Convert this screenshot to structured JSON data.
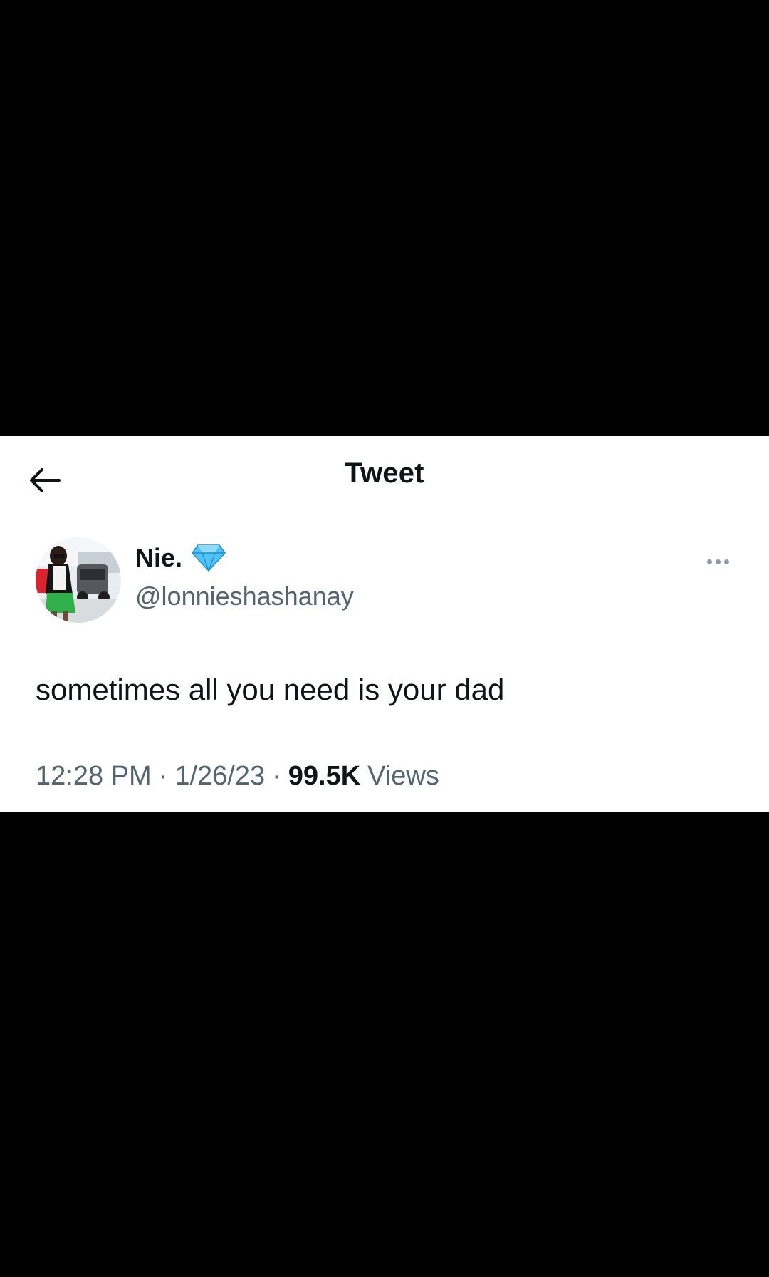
{
  "header": {
    "title": "Tweet",
    "back_icon": "arrow-left-icon"
  },
  "author": {
    "display_name": "Nie.",
    "badge_icon": "gem-icon",
    "handle": "@lonnieshashanay"
  },
  "more_icon": "more-horizontal-icon",
  "tweet": {
    "text": "sometimes all you need is your dad",
    "time": "12:28 PM",
    "date": "1/26/23",
    "separator": "·",
    "views_count": "99.5K",
    "views_label": "Views"
  },
  "colors": {
    "background": "#000000",
    "card": "#ffffff",
    "text_primary": "#0f1419",
    "text_secondary": "#536471",
    "gem": "#4fc3f7"
  }
}
